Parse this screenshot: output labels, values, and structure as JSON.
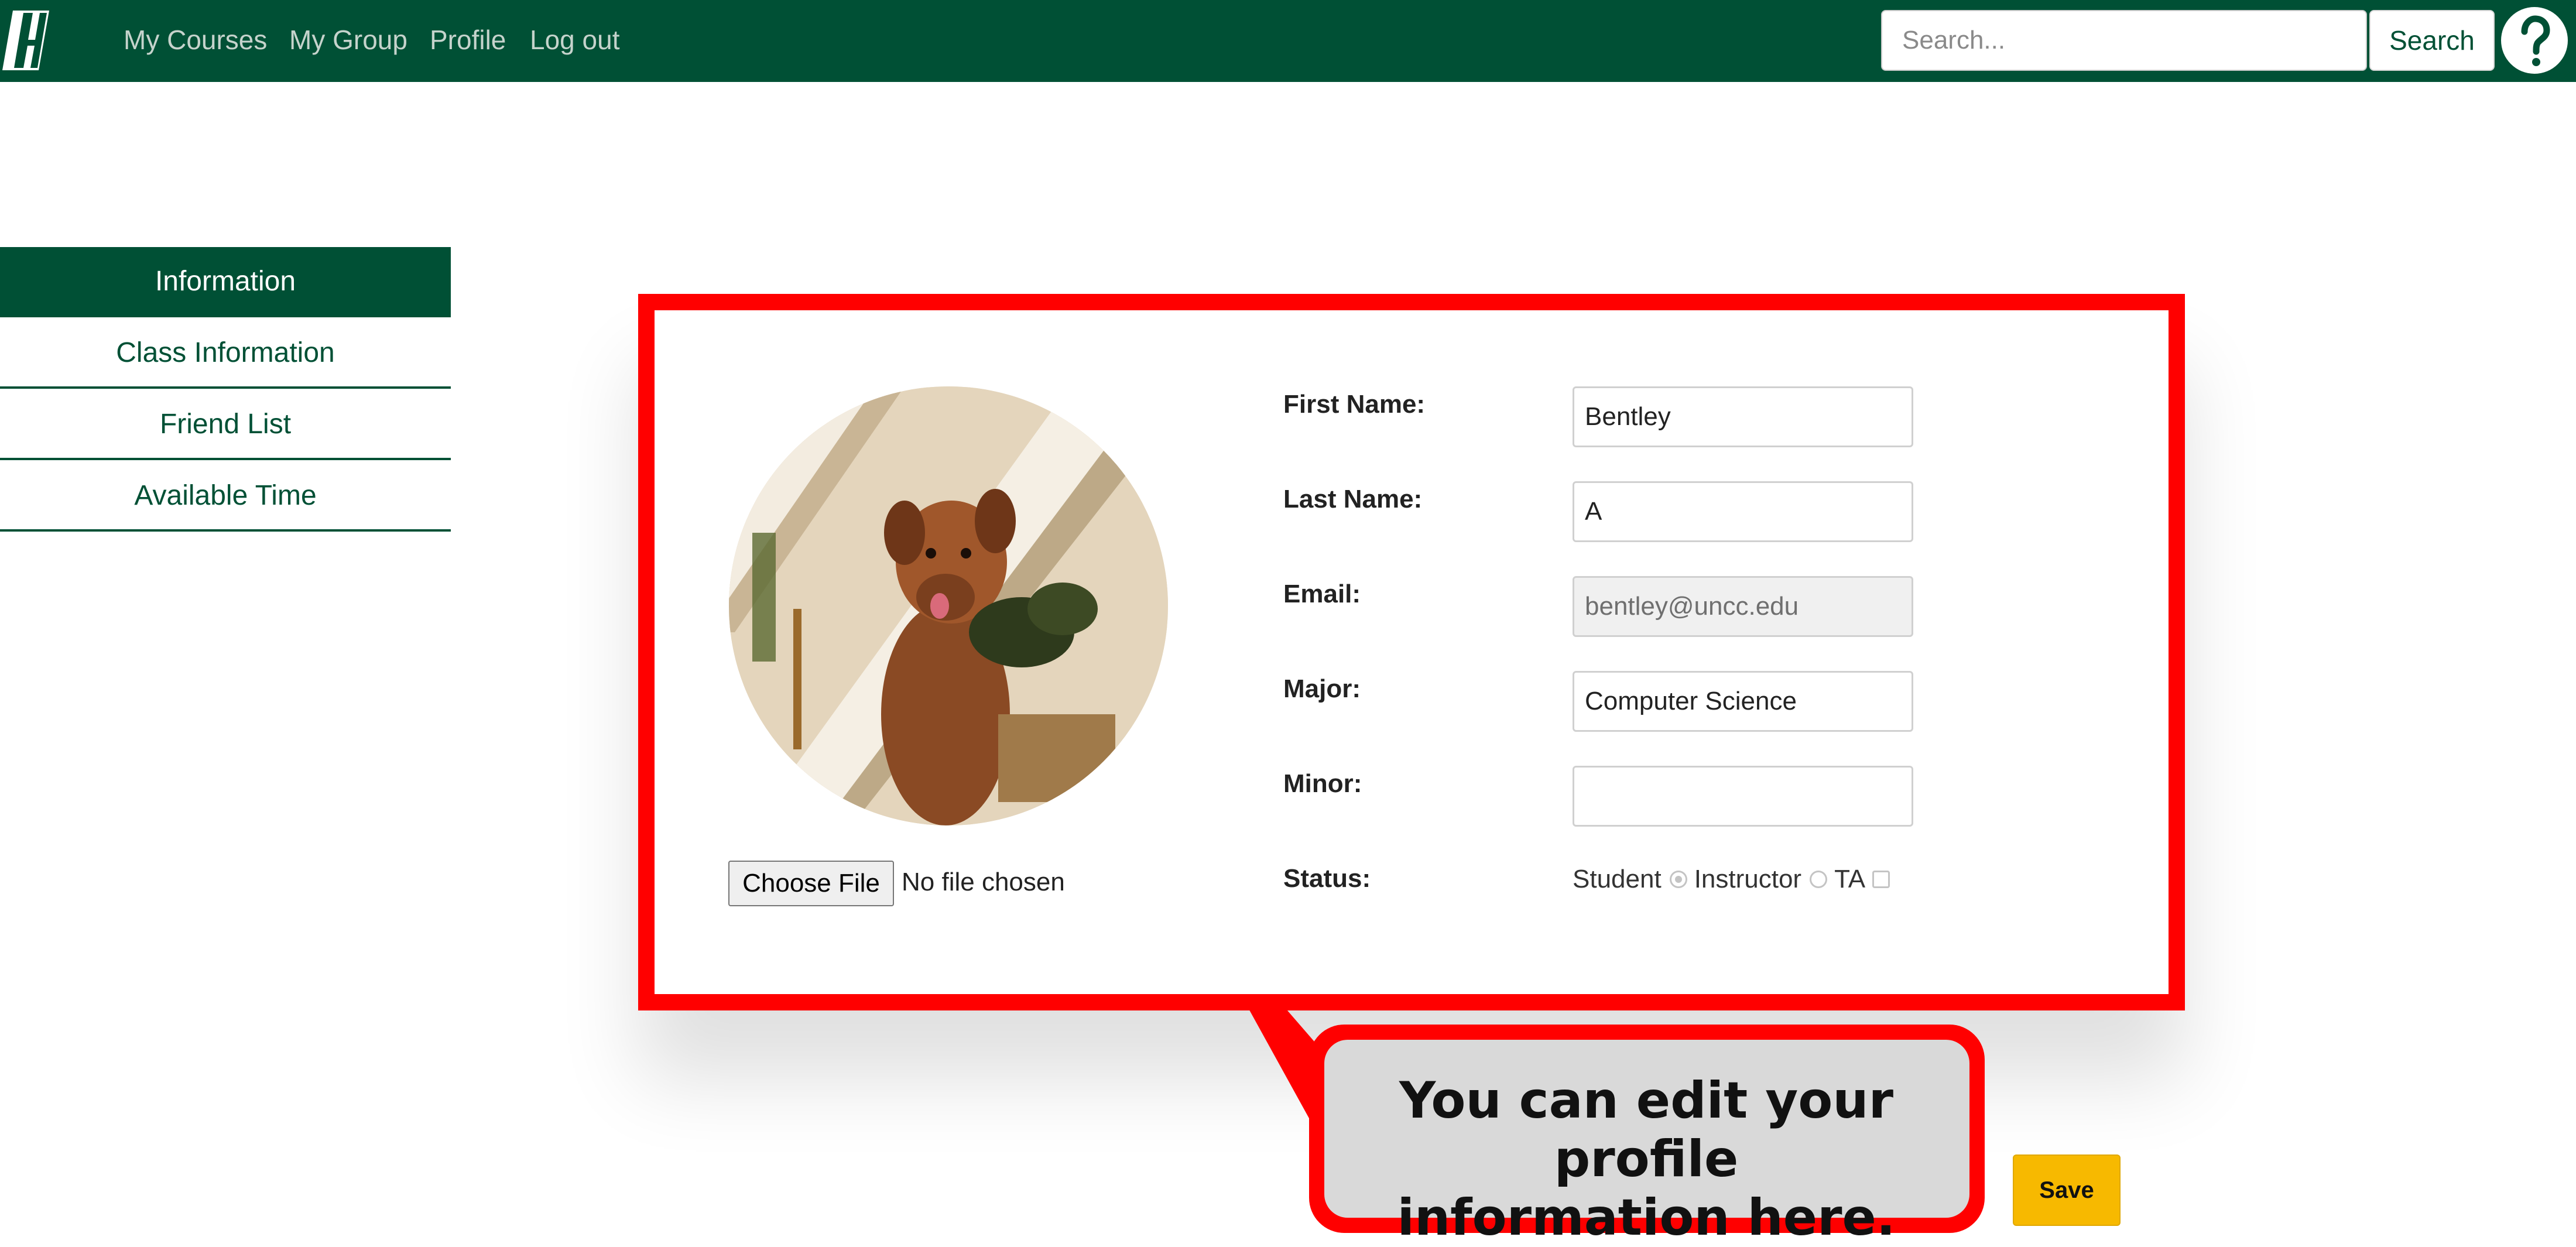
{
  "nav": {
    "links": [
      "My Courses",
      "My Group",
      "Profile",
      "Log out"
    ],
    "search_placeholder": "Search...",
    "search_button": "Search",
    "help_icon": "question-mark-icon",
    "logo_icon": "university-logo-icon"
  },
  "sidebar": {
    "items": [
      {
        "label": "Information",
        "active": true
      },
      {
        "label": "Class Information"
      },
      {
        "label": "Friend List"
      },
      {
        "label": "Available Time"
      }
    ]
  },
  "profile": {
    "file_button": "Choose File",
    "file_status": "No file chosen",
    "fields": {
      "first_name": {
        "label": "First Name:",
        "value": "Bentley"
      },
      "last_name": {
        "label": "Last Name:",
        "value": "A"
      },
      "email": {
        "label": "Email:",
        "value": "bentley@uncc.edu"
      },
      "major": {
        "label": "Major:",
        "value": "Computer Science"
      },
      "minor": {
        "label": "Minor:",
        "value": ""
      }
    },
    "status": {
      "label": "Status:",
      "options": [
        "Student",
        "Instructor",
        "TA"
      ],
      "selected": "Student"
    }
  },
  "save_button": "Save",
  "callout": {
    "line1": "You can edit your profile",
    "line2": "information here."
  },
  "colors": {
    "brand_green": "#005035",
    "highlight_red": "#ff0000",
    "save_yellow": "#f7b900",
    "callout_gray": "#d9d9d9"
  }
}
